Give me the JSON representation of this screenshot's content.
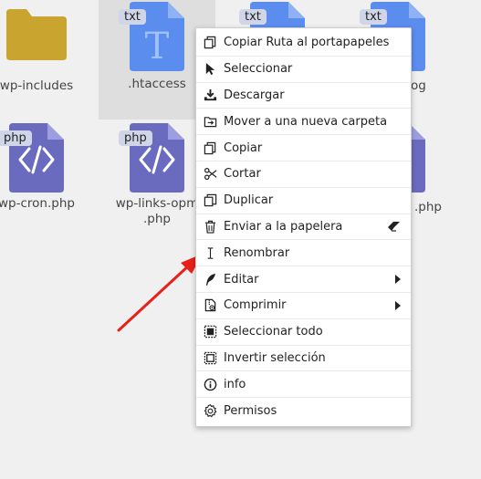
{
  "files": [
    {
      "name": "wp-includes",
      "type": "folder"
    },
    {
      "name": ".htaccess",
      "type": "txt",
      "badge": "txt"
    },
    {
      "name": "",
      "type": "txt",
      "badge": "txt"
    },
    {
      "name": "og",
      "type": "txt",
      "badge": "txt"
    },
    {
      "name": "wp-cron.php",
      "type": "php",
      "badge": "php"
    },
    {
      "name_line1": "wp-links-opm",
      "name_line2": ".php",
      "type": "php",
      "badge": "php"
    },
    {
      "name": ".php",
      "type": "php"
    }
  ],
  "menu": {
    "items": [
      {
        "label": "Copiar Ruta al portapapeles",
        "icon": "copy-icon"
      },
      {
        "label": "Seleccionar",
        "icon": "cursor-icon"
      },
      {
        "label": "Descargar",
        "icon": "download-icon"
      },
      {
        "label": "Mover a una nueva carpeta",
        "icon": "move-folder-icon"
      },
      {
        "label": "Copiar",
        "icon": "copy-icon"
      },
      {
        "label": "Cortar",
        "icon": "scissors-icon"
      },
      {
        "label": "Duplicar",
        "icon": "duplicate-icon"
      },
      {
        "label": "Enviar a la papelera",
        "icon": "trash-icon"
      },
      {
        "label": "Renombrar",
        "icon": "text-cursor-icon"
      },
      {
        "label": "Editar",
        "icon": "quill-icon"
      },
      {
        "label": "Comprimir",
        "icon": "archive-icon"
      },
      {
        "label": "Seleccionar todo",
        "icon": "select-all-icon"
      },
      {
        "label": "Invertir selección",
        "icon": "invert-selection-icon"
      },
      {
        "label": "info",
        "icon": "info-icon"
      },
      {
        "label": "Permisos",
        "icon": "gear-icon"
      }
    ]
  },
  "colors": {
    "folder": "#c9a42e",
    "txt_icon": "#5b8def",
    "php_icon": "#6a6bbf",
    "arrow": "#e8201a"
  }
}
